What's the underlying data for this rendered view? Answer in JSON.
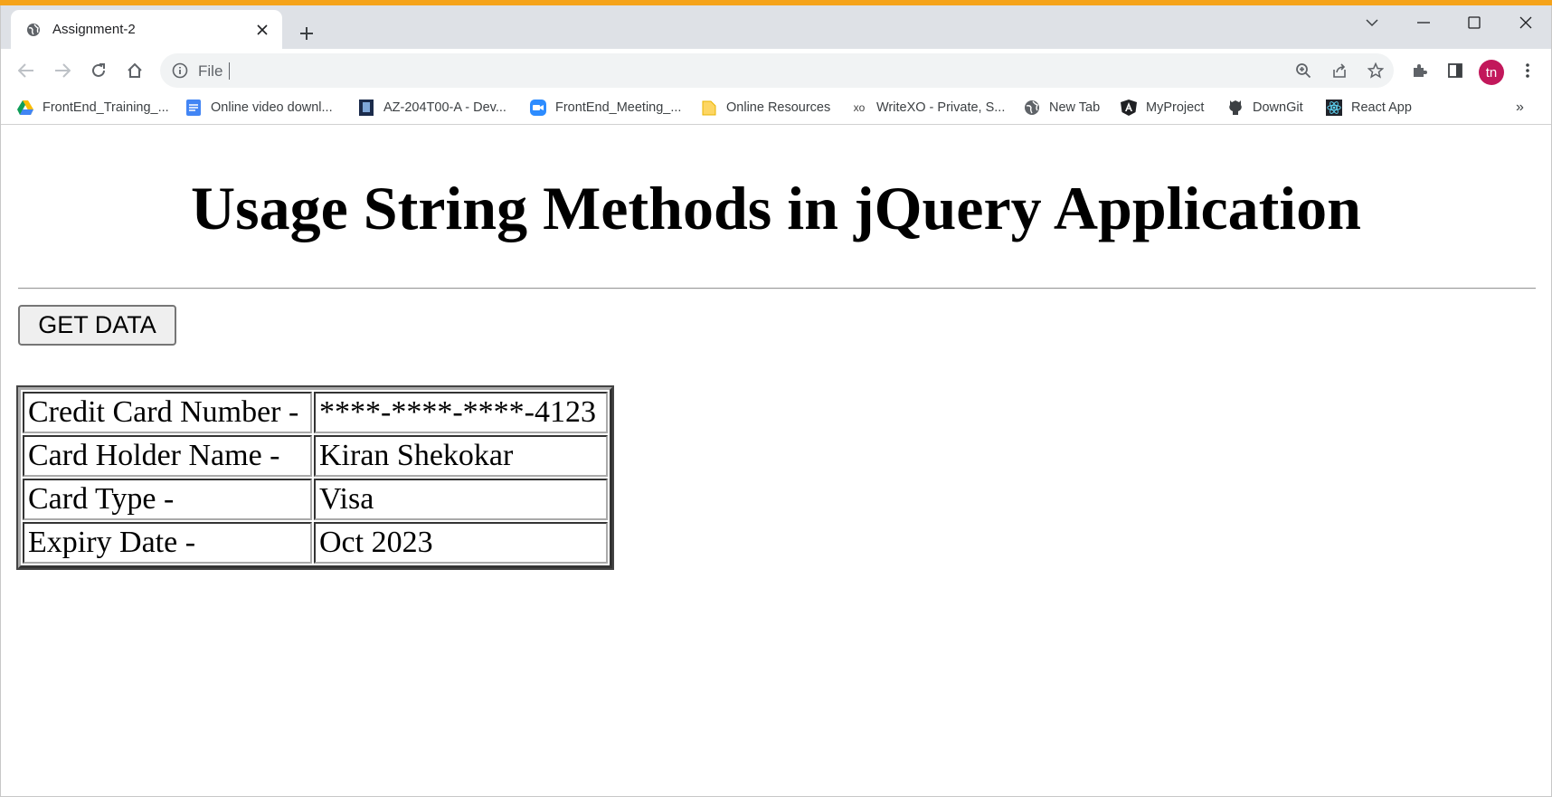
{
  "browser": {
    "tab_title": "Assignment-2",
    "omnibox": {
      "scheme_label": "File",
      "url_value": ""
    },
    "profile_initials": "tn",
    "accent_color": "#f5a31a",
    "profile_color": "#c2185b"
  },
  "bookmarks": [
    {
      "label": "FrontEnd_Training_...",
      "icon": "google-drive-icon"
    },
    {
      "label": "Online video downl...",
      "icon": "docs-icon"
    },
    {
      "label": "AZ-204T00-A - Dev...",
      "icon": "book-icon"
    },
    {
      "label": "FrontEnd_Meeting_...",
      "icon": "zoom-icon"
    },
    {
      "label": "Online Resources",
      "icon": "folder-icon"
    },
    {
      "label": "WriteXO - Private, S...",
      "icon": "xo-icon"
    },
    {
      "label": "New Tab",
      "icon": "globe-icon"
    },
    {
      "label": "MyProject",
      "icon": "angular-icon"
    },
    {
      "label": "DownGit",
      "icon": "github-icon"
    },
    {
      "label": "React App",
      "icon": "react-icon"
    }
  ],
  "page": {
    "heading": "Usage String Methods in jQuery Application",
    "get_button": "GET DATA",
    "card_table": [
      {
        "label": "Credit Card Number -",
        "value": "****-****-****-4123"
      },
      {
        "label": "Card Holder Name -",
        "value": "Kiran Shekokar"
      },
      {
        "label": "Card Type -",
        "value": "Visa"
      },
      {
        "label": "Expiry Date -",
        "value": "Oct 2023"
      }
    ]
  }
}
